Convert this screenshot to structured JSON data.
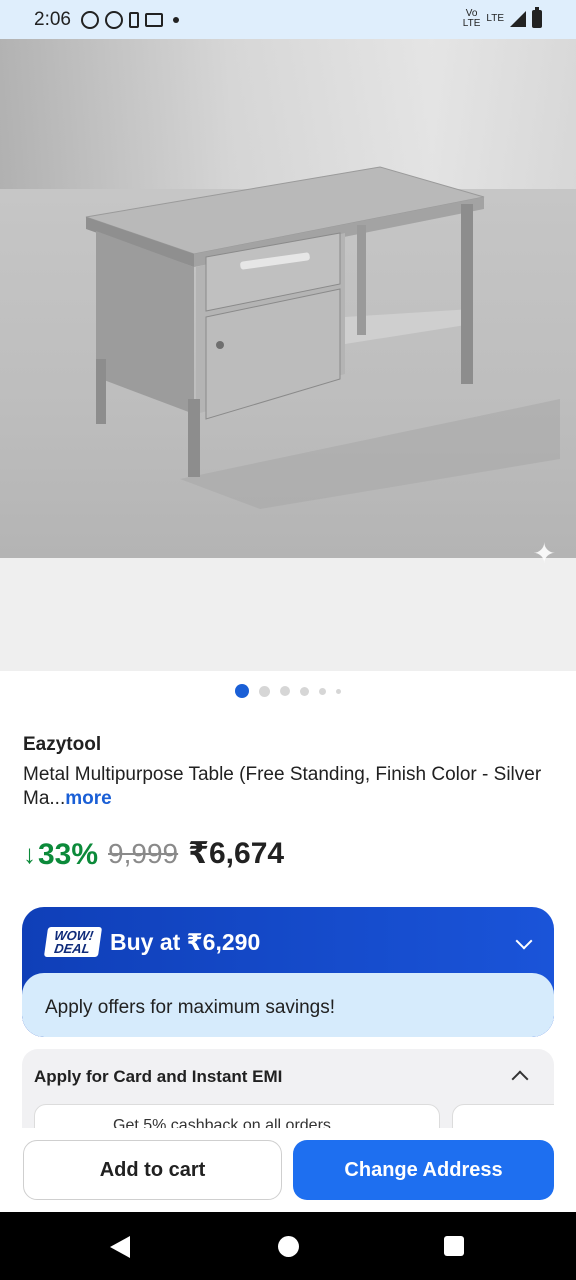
{
  "status_bar": {
    "time": "2:06",
    "network": "Vo LTE",
    "lte": "LTE"
  },
  "product": {
    "image_label": "product-photo",
    "brand": "Eazytool",
    "title": "Metal Multipurpose Table (Free Standing, Finish Color - Silver Ma...",
    "more_label": "more",
    "discount": "33%",
    "mrp": "9,999",
    "price": "₹6,674"
  },
  "carousel": {
    "count": 6,
    "active_index": 0
  },
  "deal": {
    "badge_line1": "WOW!",
    "badge_line2": "DEAL",
    "title": "Buy at ₹6,290",
    "offers_text": "Apply offers for maximum savings!",
    "accent_color": "#1446c4",
    "band_color": "#d6ebfc"
  },
  "emi": {
    "title": "Apply for Card and Instant EMI",
    "offer_text": "Get 5% cashback on all orders"
  },
  "actions": {
    "add_to_cart": "Add to cart",
    "change_address": "Change Address",
    "primary_color": "#1e6ff0"
  }
}
